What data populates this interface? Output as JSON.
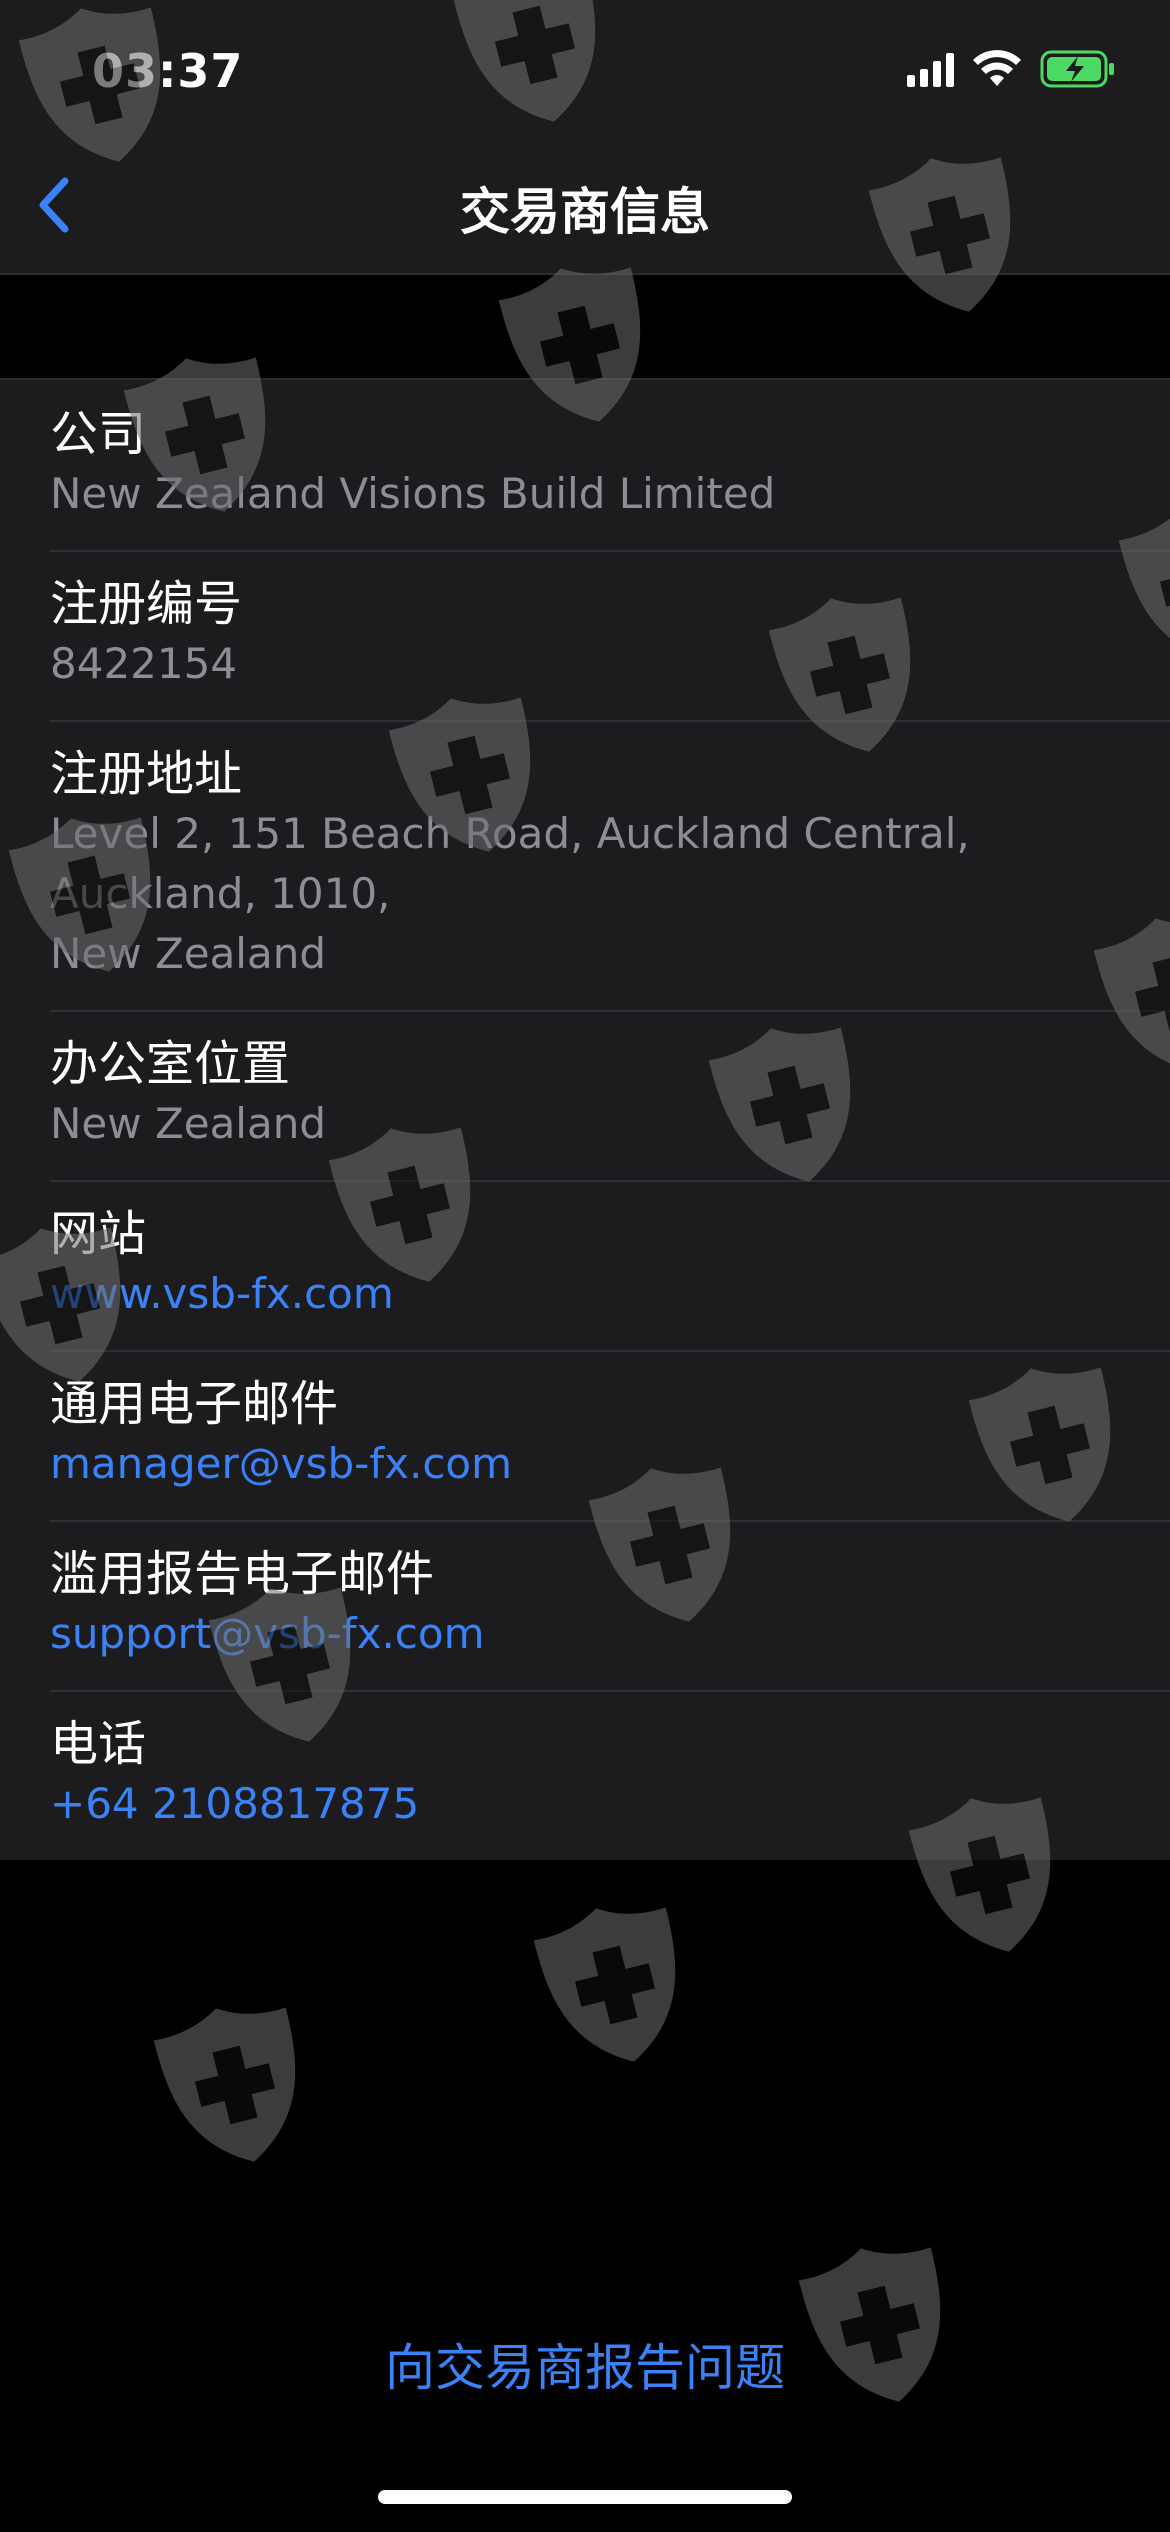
{
  "status_bar": {
    "time": "03:37",
    "icons": [
      "cellular-signal-icon",
      "wifi-icon",
      "battery-charging-icon"
    ]
  },
  "nav": {
    "back_icon": "chevron-left-icon",
    "title": "交易商信息"
  },
  "rows": [
    {
      "label": "公司",
      "value": "New Zealand Visions Build Limited",
      "link": false
    },
    {
      "label": "注册编号",
      "value": "8422154",
      "link": false
    },
    {
      "label": "注册地址",
      "value": "Level 2, 151 Beach Road, Auckland Central,\nAuckland, 1010,\nNew Zealand",
      "link": false
    },
    {
      "label": "办公室位置",
      "value": "New Zealand",
      "link": false
    },
    {
      "label": "网站",
      "value": "www.vsb-fx.com",
      "link": true
    },
    {
      "label": "通用电子邮件",
      "value": "manager@vsb-fx.com",
      "link": true
    },
    {
      "label": "滥用报告电子邮件",
      "value": "support@vsb-fx.com",
      "link": true
    },
    {
      "label": "电话",
      "value": "+64 2108817875",
      "link": true
    }
  ],
  "report_link": "向交易商报告问题",
  "colors": {
    "background": "#000000",
    "card": "#1c1c1e",
    "accent": "#3a82f7",
    "secondary_text": "#8d8d93",
    "battery": "#4cd964"
  },
  "watermark_icon": "shield-cross-icon"
}
